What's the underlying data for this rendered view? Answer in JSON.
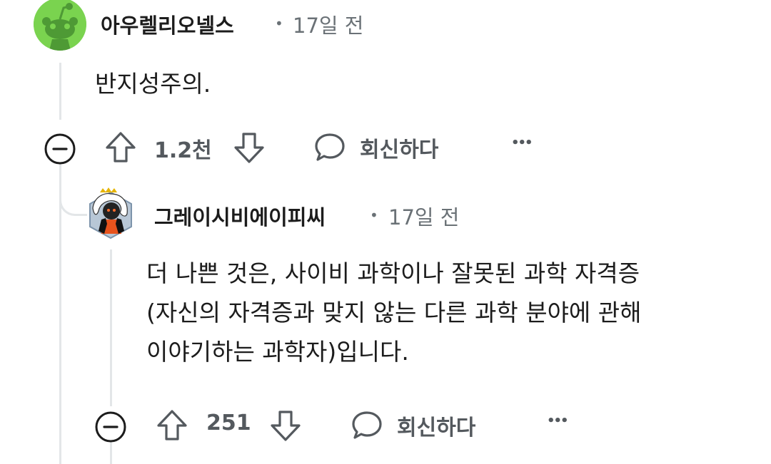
{
  "comments": [
    {
      "username": "아우렐리오넬스",
      "separator": "•",
      "time": "17일 전",
      "body": "반지성주의.",
      "upvotes": "1.2천",
      "reply_label": "회신하다",
      "more_label": "•••"
    },
    {
      "username": "그레이시비에이피씨",
      "separator": "•",
      "time": "17일 전",
      "body_lines": [
        "더 나쁜 것은, 사이비 과학이나 잘못된 과학 자격증",
        "(자신의 자격증과 맞지 않는 다른 과학 분야에 관해",
        "이야기하는 과학자)입니다."
      ],
      "upvotes": "251",
      "reply_label": "회신하다",
      "more_label": "•••"
    }
  ],
  "colors": {
    "avatar1_bg": "#7ad34f",
    "avatar2_bg": "#9fb3c8",
    "text_primary": "#1c1c1c",
    "text_meta": "#6a7176",
    "thread_line": "#e3e6e8"
  },
  "icons": [
    "collapse-icon",
    "upvote-icon",
    "downvote-icon",
    "reply-bubble-icon",
    "more-options-icon"
  ]
}
